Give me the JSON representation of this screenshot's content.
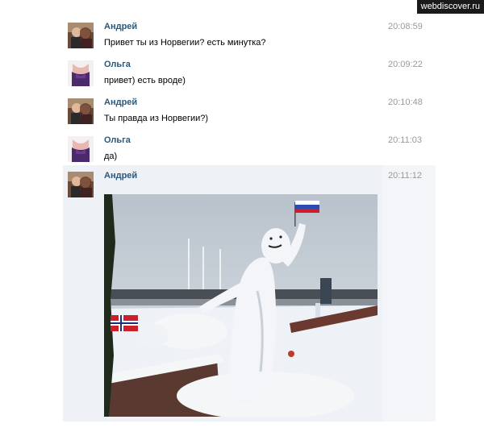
{
  "watermark": "webdiscover.ru",
  "messages": [
    {
      "author": "Андрей",
      "time": "20:08:59",
      "text": "Привет ты из Норвегии? есть минутка?"
    },
    {
      "author": "Ольга",
      "time": "20:09:22",
      "text": "привет) есть вроде)"
    },
    {
      "author": "Андрей",
      "time": "20:10:48",
      "text": "Ты правда из Норвегии?)"
    },
    {
      "author": "Ольга",
      "time": "20:11:03",
      "text": "да)"
    },
    {
      "author": "Андрей",
      "time": "20:11:12",
      "text": ""
    }
  ],
  "colors": {
    "author": "#2b587a",
    "time": "#999999",
    "highlight": "#eef1f5"
  }
}
